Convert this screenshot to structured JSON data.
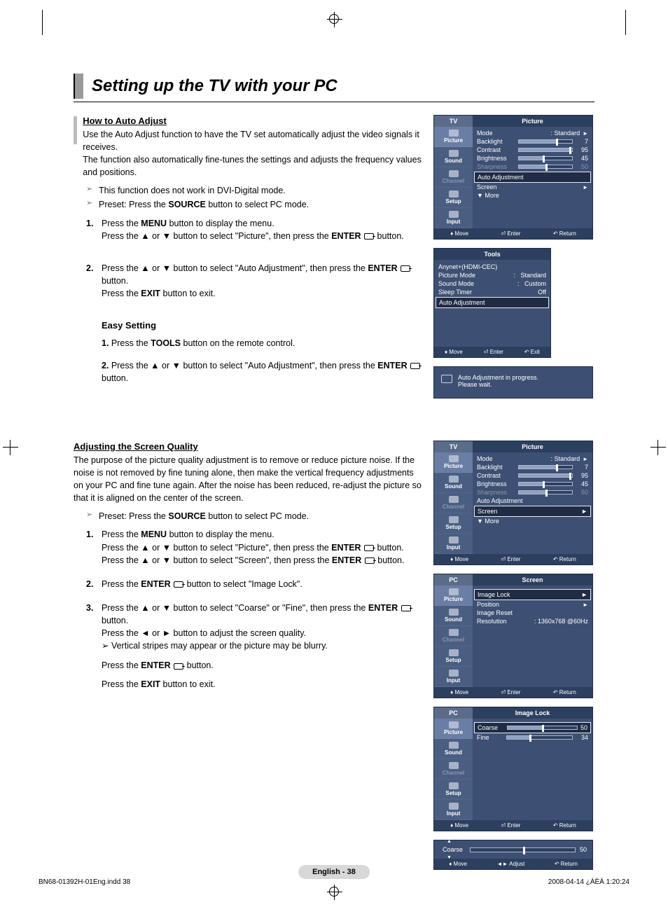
{
  "page": {
    "title": "Setting up the TV with your PC",
    "footer_page": "English - 38",
    "footer_left": "BN68-01392H-01Eng.indd   38",
    "footer_right": "2008-04-14   ¿ÀÈÄ 1:20:24"
  },
  "s1": {
    "heading": "How to Auto Adjust",
    "p1": "Use the Auto Adjust function to have the TV set automatically adjust the video signals it receives.",
    "p2": "The function also automatically fine-tunes the settings and adjusts the frequency values and positions.",
    "note1": "This function does not work in DVI-Digital mode.",
    "note2_a": "Preset: Press the ",
    "note2_b": "SOURCE",
    "note2_c": " button to select PC mode.",
    "step1_a": "Press the ",
    "step1_b": "MENU",
    "step1_c": " button to display the menu.",
    "step1_d": "Press the ▲ or ▼ button to select \"Picture\", then press the ",
    "step1_e": "ENTER",
    "step1_f": " button.",
    "step2_a": "Press the ▲ or ▼ button to select \"Auto Adjustment\", then press the ",
    "step2_b": "ENTER",
    "step2_c": "  button.",
    "step2_d": "Press the ",
    "step2_e": "EXIT",
    "step2_f": " button to exit.",
    "easy_h": "Easy Setting",
    "e1_a": "1. ",
    "e1_b": "Press the ",
    "e1_c": "TOOLS",
    "e1_d": " button on the remote control.",
    "e2_a": "2. ",
    "e2_b": "Press the ▲ or ▼ button to select \"Auto Adjustment\", then press the ",
    "e2_c": "ENTER",
    "e2_d": "  button."
  },
  "s2": {
    "heading": "Adjusting the Screen Quality",
    "p1": "The purpose of the picture quality adjustment is to remove or reduce picture noise. If the noise is not removed by fine tuning alone, then make the vertical frequency adjustments on your PC and fine tune again. After the noise has been reduced, re-adjust the picture so that it is aligned on the center of the screen.",
    "note1_a": "Preset: Press the ",
    "note1_b": "SOURCE",
    "note1_c": " button to select PC mode.",
    "st1_a": "Press the ",
    "st1_b": "MENU",
    "st1_c": " button to display the menu.",
    "st1_d": "Press the ▲ or ▼ button to select \"Picture\", then press the ",
    "st1_e": "ENTER",
    "st1_f": "  button.",
    "st1_g": "Press the ▲ or ▼ button to select \"Screen\", then press the ",
    "st1_h": "ENTER",
    "st1_i": "  button.",
    "st2_a": "Press the ",
    "st2_b": "ENTER",
    "st2_c": "  button to select \"Image Lock\".",
    "st3_a": "Press the ▲ or ▼ button to select \"Coarse\" or \"Fine\", then press the ",
    "st3_b": "ENTER",
    "st3_c": "  button.",
    "st3_d": "Press the ◄ or ► button to adjust the screen quality.",
    "st3_e": "Vertical stripes may appear or the picture may be blurry.",
    "st3_f": "Press the ",
    "st3_g": "ENTER",
    "st3_h": "  button.",
    "st3_i": "Press the ",
    "st3_j": "EXIT",
    "st3_k": " button to exit."
  },
  "osd": {
    "nav": {
      "picture": "Picture",
      "sound": "Sound",
      "channel": "Channel",
      "setup": "Setup",
      "input": "Input"
    },
    "footer": {
      "move": "Move",
      "enter": "Enter",
      "return": "Return",
      "exit": "Exit",
      "adjust": "Adjust"
    },
    "pic1": {
      "tab_l": "TV",
      "tab_r": "Picture",
      "mode_l": "Mode",
      "mode_v": ": Standard",
      "back_l": "Backlight",
      "back_v": "7",
      "con_l": "Contrast",
      "con_v": "95",
      "bri_l": "Brightness",
      "bri_v": "45",
      "shp_l": "Sharpness",
      "shp_v": "50",
      "auto": "Auto Adjustment",
      "screen": "Screen",
      "more": "▼ More"
    },
    "tools": {
      "title": "Tools",
      "any": "Anynet+(HDMI-CEC)",
      "pm_l": "Picture Mode",
      "pm_v": "Standard",
      "sm_l": "Sound Mode",
      "sm_v": "Custom",
      "sl_l": "Sleep Timer",
      "sl_v": "Off",
      "auto": "Auto Adjustment"
    },
    "msg": {
      "l1": "Auto Adjustment in progress.",
      "l2": "Please wait."
    },
    "screen": {
      "tab_l": "PC",
      "tab_r": "Screen",
      "r1": "Image Lock",
      "r2": "Position",
      "r3": "Image Reset",
      "r4_l": "Resolution",
      "r4_v": ": 1360x768 @60Hz"
    },
    "ilock": {
      "tab_l": "PC",
      "tab_r": "Image Lock",
      "c_l": "Coarse",
      "c_v": "50",
      "f_l": "Fine",
      "f_v": "34"
    },
    "coarse": {
      "label": "Coarse",
      "val": "50"
    }
  },
  "chart_data": [
    {
      "type": "bar",
      "title": "Picture OSD sliders (TV panel 1)",
      "categories": [
        "Backlight",
        "Contrast",
        "Brightness",
        "Sharpness"
      ],
      "values": [
        7,
        95,
        45,
        50
      ],
      "ylim": [
        0,
        100
      ]
    },
    {
      "type": "bar",
      "title": "Image Lock sliders",
      "categories": [
        "Coarse",
        "Fine"
      ],
      "values": [
        50,
        34
      ],
      "ylim": [
        0,
        100
      ]
    },
    {
      "type": "bar",
      "title": "Coarse adjust bar",
      "categories": [
        "Coarse"
      ],
      "values": [
        50
      ],
      "ylim": [
        0,
        100
      ]
    }
  ]
}
